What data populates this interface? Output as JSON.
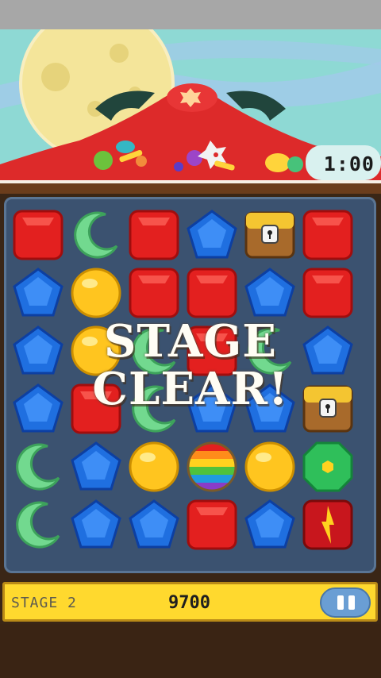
{
  "timer": {
    "label": "1:00"
  },
  "overlay": {
    "line1": "STAGE",
    "line2": "CLEAR!"
  },
  "bottom_bar": {
    "stage_label": "STAGE 2",
    "score": "9700"
  },
  "pause_button": {
    "icon": "pause-icon"
  },
  "colors": {
    "board": "#3b5270",
    "bar": "#ffd92e",
    "scene_red": "#dd2a2a"
  },
  "board": {
    "columns": 6,
    "rows": [
      [
        "red-square",
        "green-moon",
        "red-square",
        "blue-pentagon",
        "treasure-chest",
        "red-square"
      ],
      [
        "blue-pentagon",
        "yellow-orb",
        "red-square",
        "red-square",
        "blue-pentagon",
        "red-square"
      ],
      [
        "blue-pentagon",
        "yellow-orb",
        "green-moon",
        "red-square",
        "green-moon",
        "blue-pentagon"
      ],
      [
        "blue-pentagon",
        "red-square",
        "green-moon",
        "blue-pentagon",
        "blue-pentagon",
        "treasure-chest"
      ],
      [
        "green-moon",
        "blue-pentagon",
        "yellow-orb",
        "rainbow-ball",
        "yellow-orb",
        "green-octagon"
      ],
      [
        "green-moon",
        "blue-pentagon",
        "blue-pentagon",
        "red-square",
        "blue-pentagon",
        "red-lightning"
      ]
    ]
  }
}
